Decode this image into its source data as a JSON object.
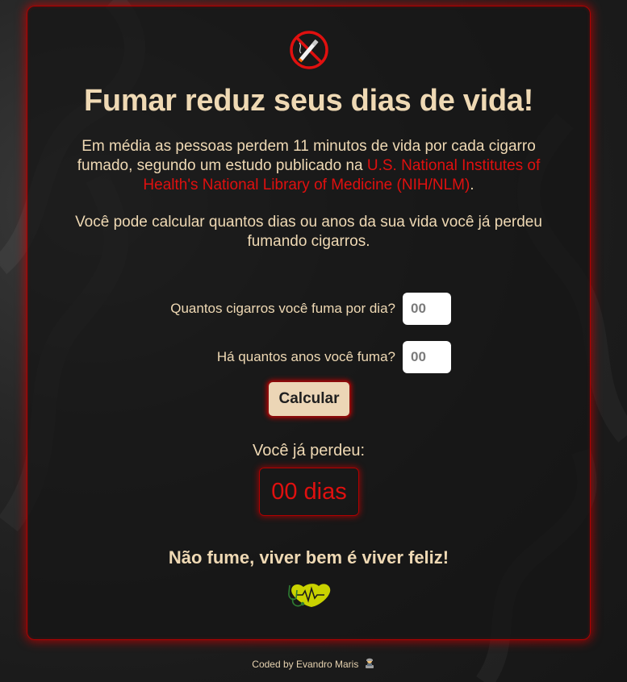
{
  "card": {
    "title": "Fumar reduz seus dias de vida!",
    "intro_text": "Em média as pessoas perdem 11 minutos de vida por cada cigarro fumado, segundo um estudo publicado na ",
    "intro_link": "U.S. National Institutes of Health's National Library of Medicine (NIH/NLM)",
    "intro_end": ".",
    "intro2": "Você pode calcular quantos dias ou anos da sua vida você já perdeu fumando cigarros."
  },
  "form": {
    "cigarettes_label": "Quantos cigarros você fuma por dia?",
    "cigarettes_placeholder": "00",
    "years_label": "Há quantos anos você fuma?",
    "years_placeholder": "00",
    "calculate_label": "Calcular"
  },
  "result": {
    "label": "Você já perdeu:",
    "value": "00 dias"
  },
  "slogan": "Não fume, viver bem é viver feliz!",
  "footer": {
    "credit": "Coded by Evandro Maris"
  },
  "icons": {
    "top": "no-smoking-icon",
    "bottom": "stethoscope-heart-icon",
    "footer": "developer-icon"
  },
  "colors": {
    "accent_red": "#e0100f",
    "text_cream": "#efd9b4",
    "button_bg": "#ecd6b6"
  }
}
